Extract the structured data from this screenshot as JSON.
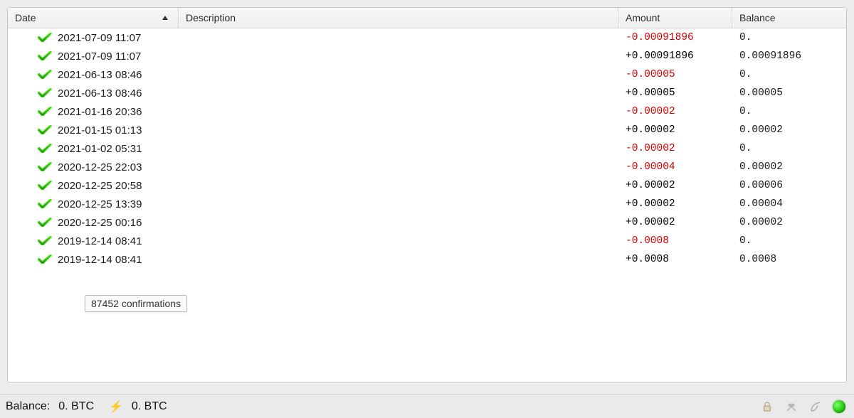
{
  "columns": {
    "date": "Date",
    "description": "Description",
    "amount": "Amount",
    "balance": "Balance"
  },
  "transactions": [
    {
      "date": "2021-07-09 11:07",
      "description": "",
      "amount": "-0.00091896",
      "amount_sign": "neg",
      "balance": "0."
    },
    {
      "date": "2021-07-09 11:07",
      "description": "",
      "amount": "+0.00091896",
      "amount_sign": "pos",
      "balance": "0.00091896"
    },
    {
      "date": "2021-06-13 08:46",
      "description": "",
      "amount": "-0.00005",
      "amount_sign": "neg",
      "balance": "0."
    },
    {
      "date": "2021-06-13 08:46",
      "description": "",
      "amount": "+0.00005",
      "amount_sign": "pos",
      "balance": "0.00005"
    },
    {
      "date": "2021-01-16 20:36",
      "description": "",
      "amount": "-0.00002",
      "amount_sign": "neg",
      "balance": "0."
    },
    {
      "date": "2021-01-15 01:13",
      "description": "",
      "amount": "+0.00002",
      "amount_sign": "pos",
      "balance": "0.00002"
    },
    {
      "date": "2021-01-02 05:31",
      "description": "",
      "amount": "-0.00002",
      "amount_sign": "neg",
      "balance": "0."
    },
    {
      "date": "2020-12-25 22:03",
      "description": "",
      "amount": "-0.00004",
      "amount_sign": "neg",
      "balance": "0.00002"
    },
    {
      "date": "2020-12-25 20:58",
      "description": "",
      "amount": "+0.00002",
      "amount_sign": "pos",
      "balance": "0.00006"
    },
    {
      "date": "2020-12-25 13:39",
      "description": "",
      "amount": "+0.00002",
      "amount_sign": "pos",
      "balance": "0.00004"
    },
    {
      "date": "2020-12-25 00:16",
      "description": "",
      "amount": "+0.00002",
      "amount_sign": "pos",
      "balance": "0.00002"
    },
    {
      "date": "2019-12-14 08:41",
      "description": "",
      "amount": "-0.0008",
      "amount_sign": "neg",
      "balance": "0."
    },
    {
      "date": "2019-12-14 08:41",
      "description": "",
      "amount": "+0.0008",
      "amount_sign": "pos",
      "balance": "0.0008"
    }
  ],
  "tooltip": "87452 confirmations",
  "statusbar": {
    "balance_label": "Balance:",
    "balance_value": "0. BTC",
    "lightning_symbol": "⚡",
    "lightning_value": "0. BTC"
  }
}
